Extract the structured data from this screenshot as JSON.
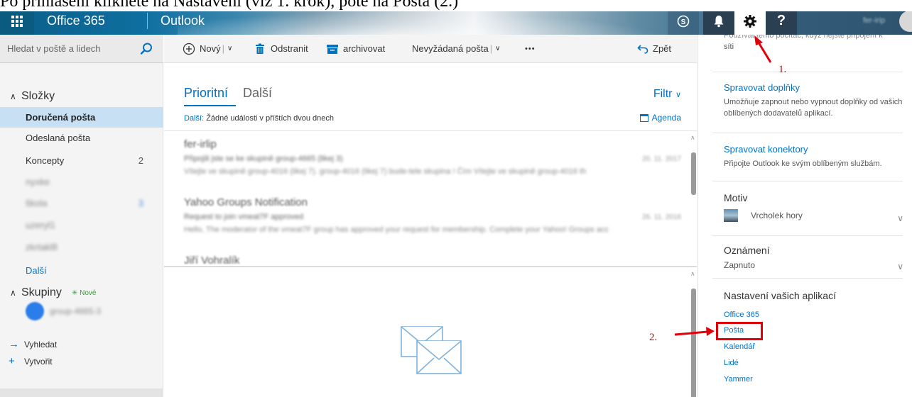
{
  "caption": "Po přihlášení klikněte na Nastavení (viz 1. krok), poté na Pošta (2.)",
  "topbar": {
    "brand": "Office 365",
    "app": "Outlook",
    "user_name": "fer-irip"
  },
  "search": {
    "placeholder": "Hledat v poště a lidech"
  },
  "folders": {
    "heading": "Složky",
    "items": [
      {
        "label": "Doručená pošta",
        "count": ""
      },
      {
        "label": "Odeslaná pošta",
        "count": ""
      },
      {
        "label": "Koncepty",
        "count": "2"
      },
      {
        "label": "nyxke",
        "count": ""
      },
      {
        "label": "škola",
        "count": "3"
      },
      {
        "label": "uzeryl1",
        "count": ""
      },
      {
        "label": "zkrtakl8",
        "count": ""
      }
    ],
    "more": "Další"
  },
  "groups": {
    "heading": "Skupiny",
    "new_badge": "Nové",
    "group_name": "group-4665-3"
  },
  "actions": {
    "search": "Vyhledat",
    "create": "Vytvořit"
  },
  "toolbar": {
    "new": "Nový",
    "delete": "Odstranit",
    "archive": "archivovat",
    "junk": "Nevyžádaná pošta",
    "more": "•••",
    "undo": "Zpět"
  },
  "list": {
    "tab_focused": "Prioritní",
    "tab_other": "Další",
    "filter": "Filtr",
    "agenda_label": "Další:",
    "agenda_text": "Žádné události v příštích dvou dnech",
    "agenda_button": "Agenda",
    "messages": [
      {
        "sender": "fer-irlip",
        "subject": "Připojili jste se ke skupině group-4665 (likej 3)",
        "preview": "Vítejte ve skupině group-4016 (likej 7). group-4016 (likej 7) bude-tele skupina ! Čím Vítejte ve skupině group-4016 th",
        "date": "20. 11. 2017"
      },
      {
        "sender": "Yahoo Groups Notification",
        "subject": "Request to join vmeat7F approved",
        "preview": "Hello, The moderator of the vmeat7F group has approved your request for membership. Complete your Yahoo! Groups acc",
        "date": "26. 11. 2016"
      },
      {
        "sender": "Jiří Vohralík",
        "subject": "",
        "preview": "",
        "date": ""
      }
    ]
  },
  "settings": {
    "top_text_1": "Používat tento počítač, když nejste připojení k",
    "top_text_2": "síti",
    "addins_link": "Spravovat doplňky",
    "addins_desc": "Umožňuje zapnout nebo vypnout doplňky od vašich oblíbených dodavatelů aplikací.",
    "connectors_link": "Spravovat konektory",
    "connectors_desc": "Připojte Outlook ke svým oblíbeným službám.",
    "theme_head": "Motiv",
    "theme_value": "Vrcholek hory",
    "notify_head": "Oznámení",
    "notify_value": "Zapnuto",
    "apps_head": "Nastavení vašich aplikací",
    "apps": [
      "Office 365",
      "Pošta",
      "Kalendář",
      "Lidé",
      "Yammer"
    ]
  },
  "annotations": {
    "step1": "1.",
    "step2": "2."
  },
  "colors": {
    "accent": "#0072c6",
    "selected": "#c7e0f4",
    "annotation": "#e0000a"
  }
}
